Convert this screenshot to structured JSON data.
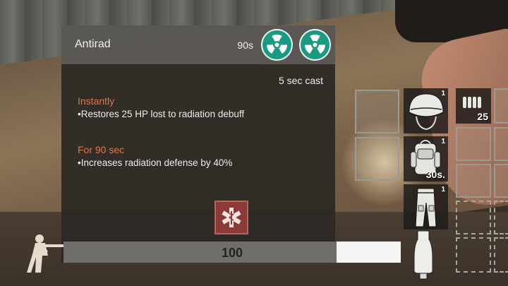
{
  "tooltip": {
    "title": "Antirad",
    "duration": "90s",
    "cast_time": "5 sec cast",
    "effects": [
      {
        "label": "Instantly",
        "text": "•Restores 25 HP lost to radiation debuff"
      },
      {
        "label": "For 90 sec",
        "text": "•Increases radiation defense by 40%"
      }
    ],
    "icons": [
      "radiation-icon",
      "radiation-icon"
    ],
    "colors": {
      "accent": "#e2744b",
      "radiation": "#1b9a83",
      "medical": "#8b3a35"
    }
  },
  "durability": {
    "value": "100",
    "fill_fraction": 0.81
  },
  "inventory": {
    "helmet_count": "1",
    "backpack_count": "1",
    "backpack_timer": "30s.",
    "pants_count": "1",
    "ammo_count": "25"
  }
}
